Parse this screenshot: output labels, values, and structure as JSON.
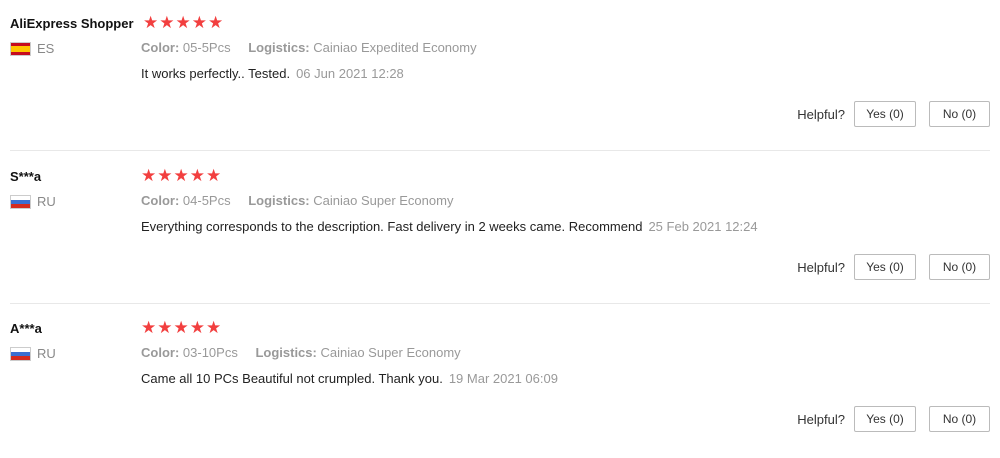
{
  "helpful_label": "Helpful?",
  "star_color": "#f23f3f",
  "reviews": [
    {
      "user": "AliExpress Shopper",
      "country": "ES",
      "flag": "spain-flag-icon",
      "rating": 5,
      "color_label": "Color:",
      "color_value": "05-5Pcs",
      "logistics_label": "Logistics:",
      "logistics_value": "Cainiao Expedited Economy",
      "text": "It works perfectly.. Tested.",
      "date": "06 Jun 2021 12:28",
      "yes_label": "Yes (0)",
      "no_label": "No (0)"
    },
    {
      "user": "S***a",
      "country": "RU",
      "flag": "russia-flag-icon",
      "rating": 5,
      "color_label": "Color:",
      "color_value": "04-5Pcs",
      "logistics_label": "Logistics:",
      "logistics_value": "Cainiao Super Economy",
      "text": "Everything corresponds to the description. Fast delivery in 2 weeks came. Recommend",
      "date": "25 Feb 2021 12:24",
      "yes_label": "Yes (0)",
      "no_label": "No (0)"
    },
    {
      "user": "A***a",
      "country": "RU",
      "flag": "russia-flag-icon",
      "rating": 5,
      "color_label": "Color:",
      "color_value": "03-10Pcs",
      "logistics_label": "Logistics:",
      "logistics_value": "Cainiao Super Economy",
      "text": "Came all 10 PCs Beautiful not crumpled. Thank you.",
      "date": "19 Mar 2021 06:09",
      "yes_label": "Yes (0)",
      "no_label": "No (0)"
    }
  ]
}
